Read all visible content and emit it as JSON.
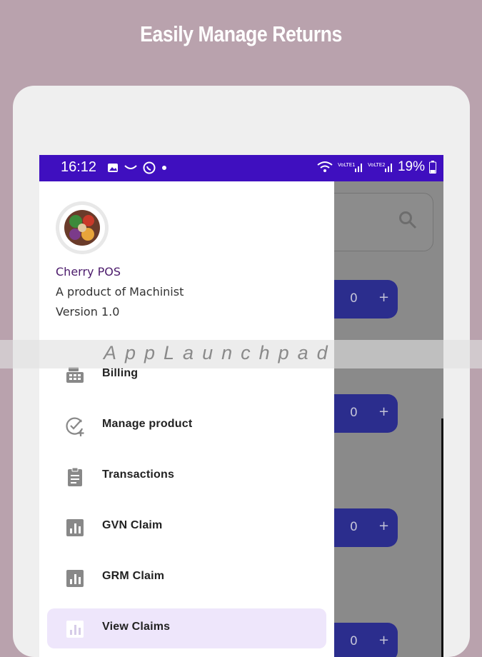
{
  "banner": {
    "headline": "Easily Manage Returns"
  },
  "status_bar": {
    "time": "16:12",
    "battery": "19%"
  },
  "drawer": {
    "app_name": "Cherry POS",
    "tagline": "A product of Machinist",
    "version": "Version 1.0",
    "items": [
      {
        "label": "Billing",
        "icon": "cash-register-icon"
      },
      {
        "label": "Manage product",
        "icon": "check-add-icon"
      },
      {
        "label": "Transactions",
        "icon": "clipboard-icon"
      },
      {
        "label": "GVN Claim",
        "icon": "bar-chart-icon"
      },
      {
        "label": "GRM Claim",
        "icon": "bar-chart-icon"
      },
      {
        "label": "View Claims",
        "icon": "bar-chart-icon"
      }
    ],
    "active_item": "View Claims"
  },
  "background": {
    "quantities": [
      "0",
      "0",
      "0",
      "0"
    ],
    "plus_label": "+"
  },
  "watermark": "AppLaunchpad",
  "colors": {
    "status_bar": "#3f0fbf",
    "page_bg": "#b9a2ad",
    "app_name": "#4b1a6b",
    "active_bg": "#eee6fb",
    "qty_button": "#2b2d8d"
  }
}
